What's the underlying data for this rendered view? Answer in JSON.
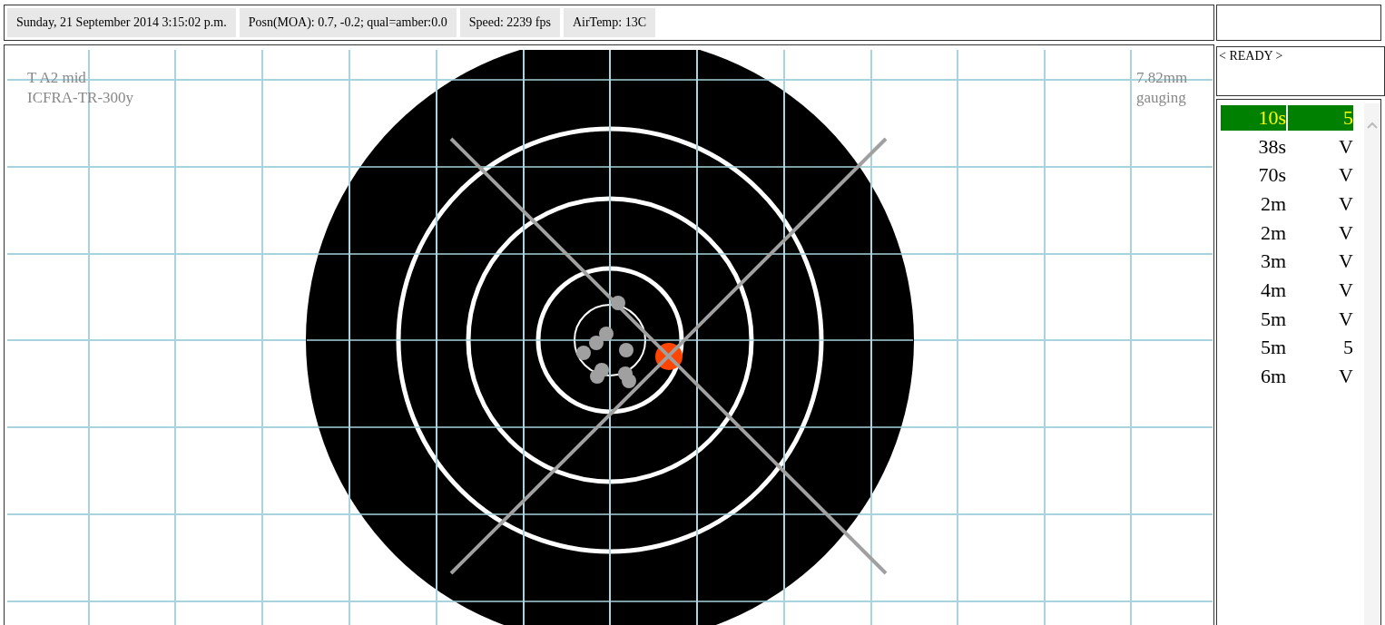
{
  "status_bar": [
    "Sunday, 21 September 2014 3:15:02 p.m.",
    "Posn(MOA): 0.7, -0.2; qual=amber:0.0",
    "Speed: 2239 fps",
    "AirTemp: 13C"
  ],
  "target": {
    "label_left": [
      "T A2 mid",
      "ICFRA-TR-300y"
    ],
    "label_right": [
      "7.82mm",
      "gauging"
    ]
  },
  "ready": "< READY >",
  "shots": [
    {
      "time": "10s",
      "score": "5",
      "selected": true
    },
    {
      "time": "38s",
      "score": "V",
      "selected": false
    },
    {
      "time": "70s",
      "score": "V",
      "selected": false
    },
    {
      "time": "2m",
      "score": "V",
      "selected": false
    },
    {
      "time": "2m",
      "score": "V",
      "selected": false
    },
    {
      "time": "3m",
      "score": "V",
      "selected": false
    },
    {
      "time": "4m",
      "score": "V",
      "selected": false
    },
    {
      "time": "5m",
      "score": "V",
      "selected": false
    },
    {
      "time": "5m",
      "score": "5",
      "selected": false
    },
    {
      "time": "6m",
      "score": "V",
      "selected": false
    }
  ]
}
